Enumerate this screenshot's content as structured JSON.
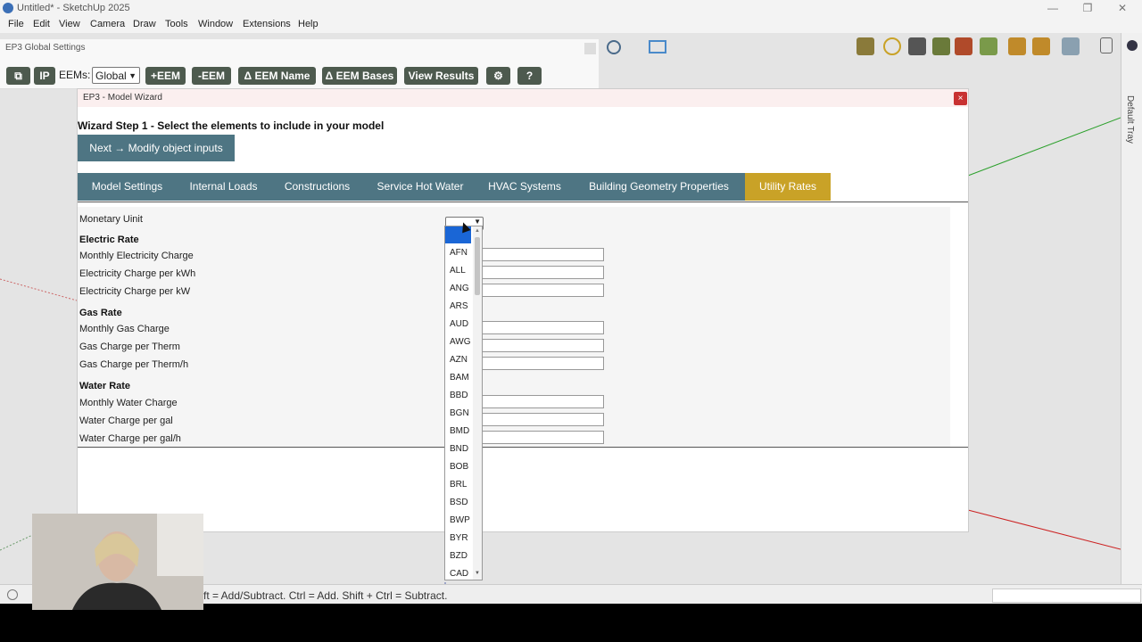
{
  "window": {
    "title": "Untitled* - SketchUp 2025"
  },
  "menu": [
    "File",
    "Edit",
    "View",
    "Camera",
    "Draw",
    "Tools",
    "Window",
    "Extensions",
    "Help"
  ],
  "tray": {
    "label": "Default Tray"
  },
  "global_settings": {
    "title": "EP3 Global Settings",
    "ip_label": "IP",
    "eems_label": "EEMs:",
    "eems_value": "Global",
    "buttons": [
      "+EEM",
      "-EEM",
      "Δ EEM Name",
      "Δ EEM Bases",
      "View Results"
    ]
  },
  "wizard": {
    "title": "EP3 - Model Wizard",
    "close_label": "×",
    "step_label": "Wizard Step 1 - Select the elements to include in your model",
    "next_button": "Next → Modify object inputs",
    "tabs": [
      {
        "label": "Model Settings",
        "active": false
      },
      {
        "label": "Internal Loads",
        "active": false
      },
      {
        "label": "Constructions",
        "active": false
      },
      {
        "label": "Service Hot Water",
        "active": false
      },
      {
        "label": "HVAC Systems",
        "active": false
      },
      {
        "label": "Building Geometry Properties",
        "active": false
      },
      {
        "label": "Utility Rates",
        "active": true
      }
    ],
    "form": {
      "monetary_unit_label": "Monetary Uinit",
      "electric_rate_heading": "Electric Rate",
      "monthly_electricity_charge": "Monthly Electricity Charge",
      "electricity_per_kwh": "Electricity Charge per kWh",
      "electricity_per_kw": "Electricity Charge per kW",
      "gas_rate_heading": "Gas Rate",
      "monthly_gas_charge": "Monthly Gas Charge",
      "gas_per_therm": "Gas Charge per Therm",
      "gas_per_therm_h": "Gas Charge per Therm/h",
      "water_rate_heading": "Water Rate",
      "monthly_water_charge": "Monthly Water Charge",
      "water_per_gal": "Water Charge per gal",
      "water_per_gal_h": "Water Charge per gal/h"
    },
    "currency_options": [
      "AFN",
      "ALL",
      "ANG",
      "ARS",
      "AUD",
      "AWG",
      "AZN",
      "BAM",
      "BBD",
      "BGN",
      "BMD",
      "BND",
      "BOB",
      "BRL",
      "BSD",
      "BWP",
      "BYR",
      "BZD",
      "CAD"
    ]
  },
  "status": {
    "text": "ft = Add/Subtract. Ctrl = Add. Shift + Ctrl = Subtract."
  },
  "colors": {
    "tab_bg": "#4e7583",
    "tab_active": "#c9a227",
    "global_btn": "#4d5a4e",
    "close_red": "#c83232",
    "selection_blue": "#1a66d6"
  }
}
